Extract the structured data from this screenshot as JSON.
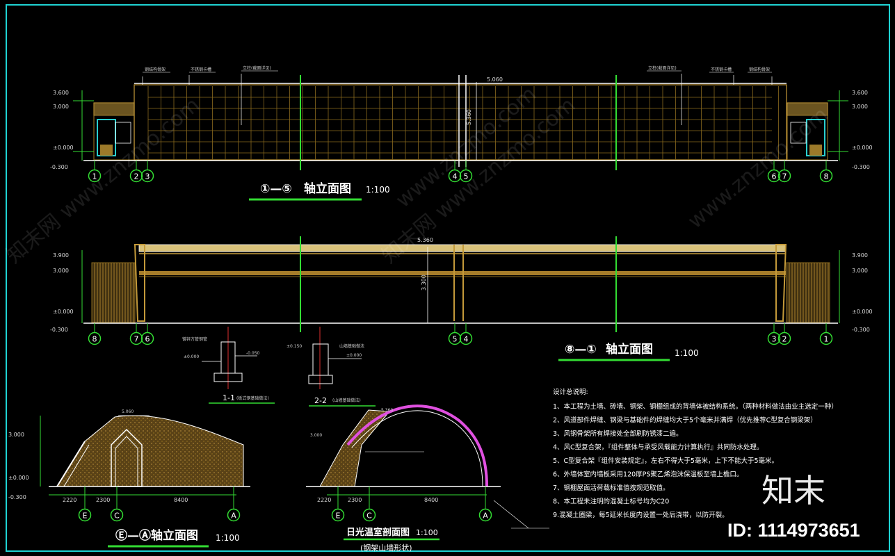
{
  "drawing": {
    "border_color": "#1fd3d3",
    "grid_color": "#8a6a1e",
    "axis_color": "#33dd33",
    "arch_color": "#e050e0",
    "titles": {
      "elev_1_5": {
        "axes": "①—⑤",
        "name": "轴立面图",
        "scale": "1:100"
      },
      "elev_8_1": {
        "axes": "⑧—①",
        "name": "轴立面图",
        "scale": "1:100"
      },
      "elev_e_a": {
        "axes": "Ⓔ—Ⓐ",
        "name": "轴立面图",
        "scale": "1:100"
      },
      "section": {
        "name": "日光温室剖面图",
        "scale": "1:100",
        "sub": "(钢架山墙形状)"
      }
    },
    "details": {
      "d11": {
        "label": "1-1",
        "sub": "(板式钢基础做法)"
      },
      "d22": {
        "label": "2-2",
        "sub": "(山墙基础做法)"
      }
    },
    "axes_top": [
      "1",
      "2",
      "3",
      "4",
      "5",
      "6",
      "7",
      "8"
    ],
    "axes_mid": [
      "8",
      "7",
      "6",
      "5",
      "4",
      "3",
      "2",
      "1"
    ],
    "axes_bottom_left": [
      "E",
      "C",
      "A"
    ],
    "axes_bottom_mid": [
      "E",
      "C",
      "A"
    ],
    "elev_top_levels": [
      "3.600",
      "3.000",
      "±0.000",
      "-0.300"
    ],
    "elev_top_dims": [
      "5.060",
      "5.360"
    ],
    "elev_mid_levels": [
      "3.900",
      "3.000",
      "±0.000",
      "-0.300"
    ],
    "elev_mid_dims": [
      "5.360",
      "3.300"
    ],
    "bottom_dims": [
      "2220",
      "2300",
      "8400"
    ],
    "bottom_levels": [
      "3.000",
      "±0.000",
      "-0.300",
      "5.060",
      "5.360"
    ],
    "notes_title": "设计总说明:",
    "notes": [
      "1、本工程为土墙、砖墙、钢架、钢棚组成的背墙体被结构系统。（两种材料做法由业主选定一种）",
      "2、风道部件焊缝、钢梁与基础件的焊缝均大于5个毫米并满焊（优先推荐C型复合钢梁架）",
      "3、风钢骨架所有焊接处全部刷防锈漆二遍。",
      "4、风C型复合架，『组件整体与承受风载能力计算执行』共同防水处理。",
      "5、C型复合架『组件安装规定』，左右不得大于5毫米，上下不能大于5毫米。",
      "6、外墙体室内墙板采用120厚PS聚乙烯泡沫保温板至墙上檐口。",
      "7、钢棚屋面活荷载标准值按规范取值。",
      "8、本工程未注明的混凝土标号均为C20",
      "9.混凝土圈梁，每5延米长度内设置一处后浇带，以防开裂。"
    ],
    "watermarks": [
      "知末网 www.znzmo.com",
      "www.znzmo.com",
      "知末网 www.znzmo.com",
      "www.znzmo.com"
    ],
    "logo": "知末",
    "id_text": "ID: 1114973651"
  }
}
